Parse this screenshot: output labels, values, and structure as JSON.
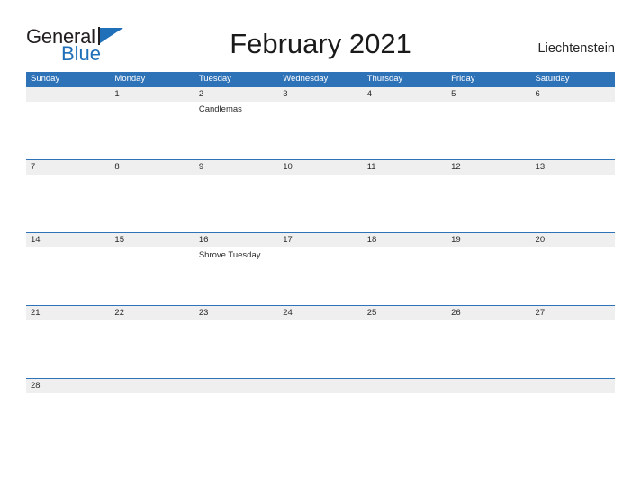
{
  "brand": {
    "name_part1": "General",
    "name_part2": "Blue",
    "flag_icon": "blue-flag-triangle-icon",
    "color_dark": "#231f20",
    "color_blue": "#1f70b8"
  },
  "header": {
    "title": "February 2021",
    "region": "Liechtenstein"
  },
  "calendar": {
    "colors": {
      "header_blue": "#2e72b8",
      "date_band_gray": "#efefef",
      "header_text": "#ffffff",
      "body_text": "#2b2b2b"
    },
    "weekdays": [
      "Sunday",
      "Monday",
      "Tuesday",
      "Wednesday",
      "Thursday",
      "Friday",
      "Saturday"
    ],
    "weeks": [
      [
        {
          "day": "",
          "event": ""
        },
        {
          "day": "1",
          "event": ""
        },
        {
          "day": "2",
          "event": "Candlemas"
        },
        {
          "day": "3",
          "event": ""
        },
        {
          "day": "4",
          "event": ""
        },
        {
          "day": "5",
          "event": ""
        },
        {
          "day": "6",
          "event": ""
        }
      ],
      [
        {
          "day": "7",
          "event": ""
        },
        {
          "day": "8",
          "event": ""
        },
        {
          "day": "9",
          "event": ""
        },
        {
          "day": "10",
          "event": ""
        },
        {
          "day": "11",
          "event": ""
        },
        {
          "day": "12",
          "event": ""
        },
        {
          "day": "13",
          "event": ""
        }
      ],
      [
        {
          "day": "14",
          "event": ""
        },
        {
          "day": "15",
          "event": ""
        },
        {
          "day": "16",
          "event": "Shrove Tuesday"
        },
        {
          "day": "17",
          "event": ""
        },
        {
          "day": "18",
          "event": ""
        },
        {
          "day": "19",
          "event": ""
        },
        {
          "day": "20",
          "event": ""
        }
      ],
      [
        {
          "day": "21",
          "event": ""
        },
        {
          "day": "22",
          "event": ""
        },
        {
          "day": "23",
          "event": ""
        },
        {
          "day": "24",
          "event": ""
        },
        {
          "day": "25",
          "event": ""
        },
        {
          "day": "26",
          "event": ""
        },
        {
          "day": "27",
          "event": ""
        }
      ],
      [
        {
          "day": "28",
          "event": ""
        },
        {
          "day": "",
          "event": ""
        },
        {
          "day": "",
          "event": ""
        },
        {
          "day": "",
          "event": ""
        },
        {
          "day": "",
          "event": ""
        },
        {
          "day": "",
          "event": ""
        },
        {
          "day": "",
          "event": ""
        }
      ]
    ]
  }
}
